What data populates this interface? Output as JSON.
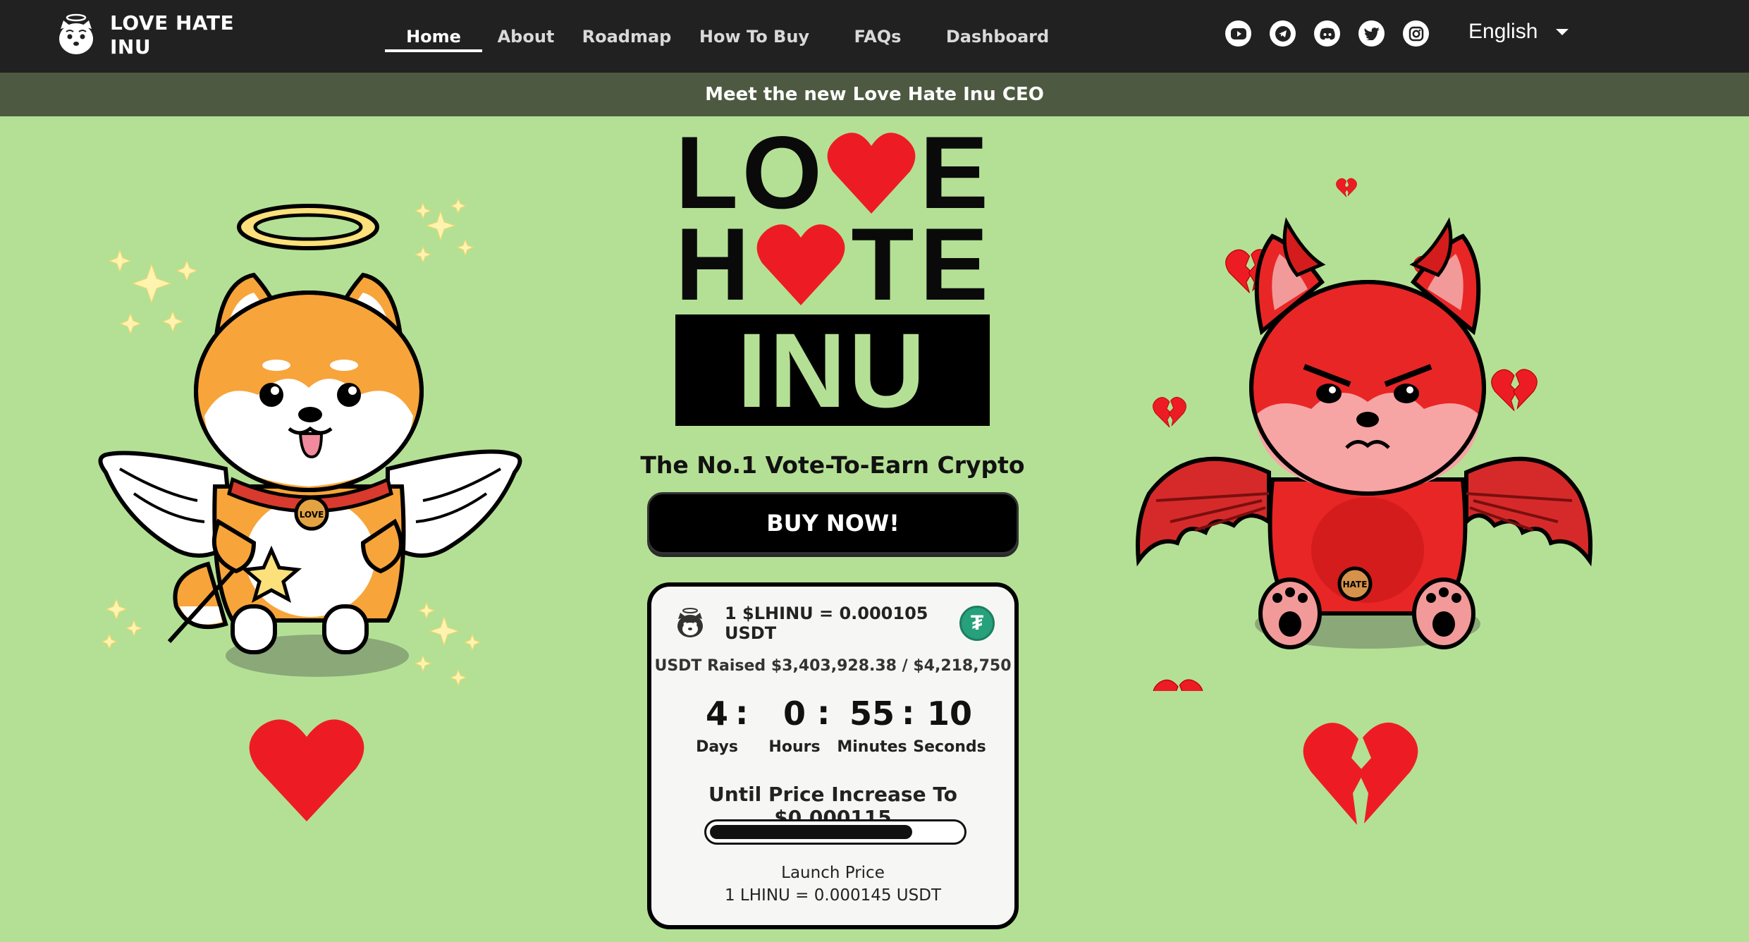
{
  "brand": {
    "name": "LOVE HATE INU",
    "logo_icon": "inu-face-icon"
  },
  "nav": {
    "items": [
      {
        "label": "Home",
        "active": true
      },
      {
        "label": "About",
        "active": false
      },
      {
        "label": "Roadmap",
        "active": false
      },
      {
        "label": "How To Buy",
        "active": false
      },
      {
        "label": "FAQs",
        "active": false
      },
      {
        "label": "Dashboard",
        "active": false
      }
    ],
    "socials": [
      "youtube-icon",
      "telegram-icon",
      "discord-icon",
      "twitter-icon",
      "instagram-icon"
    ],
    "language": "English"
  },
  "announcement": "Meet the new Love Hate Inu CEO",
  "hero": {
    "title_line1": [
      "L",
      "O",
      "♥",
      "E"
    ],
    "title_line2": [
      "H",
      "♥",
      "T",
      "E"
    ],
    "title_line3": "INU",
    "tagline": "The No.1 Vote-To-Earn Crypto",
    "buy_label": "BUY NOW!"
  },
  "presale": {
    "price": "1 $LHINU = 0.000105 USDT",
    "currency_icon": "tether-icon",
    "currency_symbol": "₮",
    "raised": "USDT Raised $3,403,928.38 / $4,218,750",
    "countdown": [
      {
        "value": "4",
        "label": "Days"
      },
      {
        "value": "0",
        "label": "Hours"
      },
      {
        "value": "55",
        "label": "Minutes"
      },
      {
        "value": "10",
        "label": "Seconds"
      }
    ],
    "until": "Until Price Increase To $0.000115",
    "progress_fraction": 0.807,
    "launch_title": "Launch Price",
    "launch_value": "1 LHINU = 0.000145 USDT"
  },
  "colors": {
    "background": "#b4e095",
    "nav": "#212121",
    "announcement": "#4d5a41",
    "heart": "#ed1c24",
    "tether": "#26a17b"
  }
}
